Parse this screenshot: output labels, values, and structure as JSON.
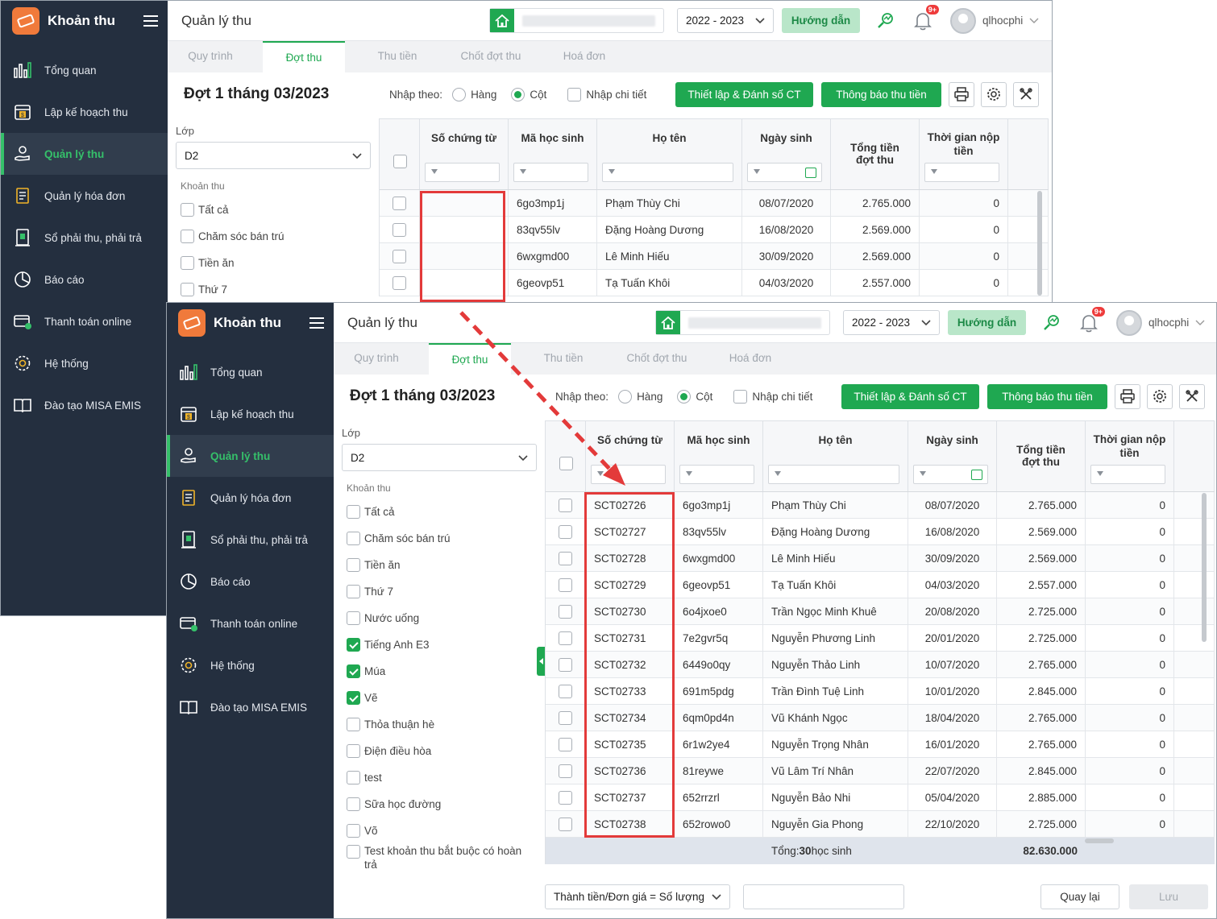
{
  "app": {
    "brand_title": "Khoản thu",
    "page_title": "Quản lý thu",
    "school_year": "2022 - 2023",
    "guide_label": "Hướng dẫn",
    "notif_badge": "9+",
    "username": "qlhocphi"
  },
  "sidebar": {
    "items": [
      {
        "label": "Tổng quan",
        "icon": "chart-bars-icon"
      },
      {
        "label": "Lập kế hoạch thu",
        "icon": "calendar-money-icon"
      },
      {
        "label": "Quản lý thu",
        "icon": "hand-coin-icon",
        "active": true
      },
      {
        "label": "Quản lý hóa đơn",
        "icon": "invoice-icon"
      },
      {
        "label": "Sổ phải thu, phải trả",
        "icon": "ledger-icon"
      },
      {
        "label": "Báo cáo",
        "icon": "pie-chart-icon"
      },
      {
        "label": "Thanh toán online",
        "icon": "online-payment-icon"
      },
      {
        "label": "Hệ thống",
        "icon": "gear-icon"
      },
      {
        "label": "Đào tạo MISA EMIS",
        "icon": "book-icon"
      }
    ]
  },
  "tabs": [
    "Quy trình",
    "Đợt thu",
    "Thu tiền",
    "Chốt đợt thu",
    "Hoá đơn"
  ],
  "toolbar": {
    "round_title": "Đợt 1 tháng 03/2023",
    "entry_label": "Nhập theo:",
    "opt_row": "Hàng",
    "opt_col": "Cột",
    "opt_detail": "Nhập chi tiết",
    "btn_setup": "Thiết lập & Đánh số CT",
    "btn_notify": "Thông báo thu tiền"
  },
  "filters": {
    "class_label": "Lớp",
    "class_value": "D2",
    "fee_header": "Khoản thu",
    "fees": [
      {
        "label": "Tất cả",
        "checked": false
      },
      {
        "label": "Chăm sóc bán trú",
        "checked": false
      },
      {
        "label": "Tiền ăn",
        "checked": false
      },
      {
        "label": "Thứ 7",
        "checked": false
      },
      {
        "label": "Nước uống",
        "checked": false
      },
      {
        "label": "Tiếng Anh E3",
        "checked": true
      },
      {
        "label": "Múa",
        "checked": true
      },
      {
        "label": "Vẽ",
        "checked": true
      },
      {
        "label": "Thỏa thuận hè",
        "checked": false
      },
      {
        "label": "Điện điều hòa",
        "checked": false
      },
      {
        "label": "test",
        "checked": false
      },
      {
        "label": "Sữa học đường",
        "checked": false
      },
      {
        "label": "Võ",
        "checked": false
      },
      {
        "label": "Test khoản thu bắt buộc có hoàn trả",
        "checked": false
      }
    ]
  },
  "grid": {
    "headers": {
      "voucher": "Số chứng từ",
      "student_code": "Mã học sinh",
      "name": "Họ tên",
      "dob": "Ngày sinh",
      "total": "Tổng tiền đợt thu",
      "pay_time": "Thời gian nộp tiền"
    },
    "rows": [
      {
        "voucher": "SCT02726",
        "code": "6go3mp1j",
        "name": "Phạm Thùy Chi",
        "dob": "08/07/2020",
        "total": "2.765.000",
        "pay": "0"
      },
      {
        "voucher": "SCT02727",
        "code": "83qv55lv",
        "name": "Đặng Hoàng Dương",
        "dob": "16/08/2020",
        "total": "2.569.000",
        "pay": "0"
      },
      {
        "voucher": "SCT02728",
        "code": "6wxgmd00",
        "name": "Lê Minh Hiếu",
        "dob": "30/09/2020",
        "total": "2.569.000",
        "pay": "0"
      },
      {
        "voucher": "SCT02729",
        "code": "6geovp51",
        "name": "Tạ Tuấn Khôi",
        "dob": "04/03/2020",
        "total": "2.557.000",
        "pay": "0"
      },
      {
        "voucher": "SCT02730",
        "code": "6o4jxoe0",
        "name": "Trần Ngọc Minh Khuê",
        "dob": "20/08/2020",
        "total": "2.725.000",
        "pay": "0"
      },
      {
        "voucher": "SCT02731",
        "code": "7e2gvr5q",
        "name": "Nguyễn Phương Linh",
        "dob": "20/01/2020",
        "total": "2.725.000",
        "pay": "0"
      },
      {
        "voucher": "SCT02732",
        "code": "6449o0qy",
        "name": "Nguyễn Thảo Linh",
        "dob": "10/07/2020",
        "total": "2.765.000",
        "pay": "0"
      },
      {
        "voucher": "SCT02733",
        "code": "691m5pdg",
        "name": "Trần Đình Tuệ Linh",
        "dob": "10/01/2020",
        "total": "2.845.000",
        "pay": "0"
      },
      {
        "voucher": "SCT02734",
        "code": "6qm0pd4n",
        "name": "Vũ Khánh Ngọc",
        "dob": "18/04/2020",
        "total": "2.765.000",
        "pay": "0"
      },
      {
        "voucher": "SCT02735",
        "code": "6r1w2ye4",
        "name": "Nguyễn Trọng Nhân",
        "dob": "16/01/2020",
        "total": "2.765.000",
        "pay": "0"
      },
      {
        "voucher": "SCT02736",
        "code": "81reywe",
        "name": "Vũ Lâm Trí Nhân",
        "dob": "22/07/2020",
        "total": "2.845.000",
        "pay": "0"
      },
      {
        "voucher": "SCT02737",
        "code": "652rrzrl",
        "name": "Nguyễn Bảo Nhi",
        "dob": "05/04/2020",
        "total": "2.885.000",
        "pay": "0"
      },
      {
        "voucher": "SCT02738",
        "code": "652rowo0",
        "name": "Nguyễn Gia Phong",
        "dob": "22/10/2020",
        "total": "2.725.000",
        "pay": "0"
      }
    ],
    "footer": {
      "total_prefix": "Tổng: ",
      "student_count": "30",
      "total_suffix": " học sinh",
      "grand_total": "82.630.000"
    }
  },
  "bottom": {
    "formula": "Thành tiền/Đơn giá = Số lượng",
    "undo": "Quay lại",
    "save": "Lưu"
  },
  "colors": {
    "accent": "#1fa851",
    "sidebar": "#242f3f",
    "highlight": "#e33a3a"
  }
}
